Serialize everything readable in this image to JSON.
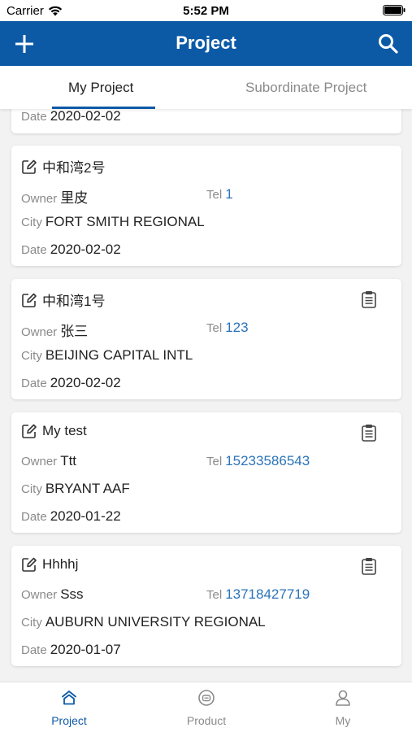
{
  "status_bar": {
    "carrier": "Carrier",
    "time": "5:52 PM"
  },
  "nav": {
    "title": "Project",
    "add_icon": "plus-icon",
    "search_icon": "search-icon"
  },
  "tabs": [
    {
      "label": "My Project",
      "active": true
    },
    {
      "label": "Subordinate Project",
      "active": false
    }
  ],
  "labels": {
    "owner": "Owner",
    "tel": "Tel",
    "city": "City",
    "date": "Date"
  },
  "projects": [
    {
      "name": "",
      "owner": "",
      "tel": "",
      "city": "",
      "date": "2020-02-02",
      "has_clipboard": false
    },
    {
      "name": "中和湾2号",
      "owner": "里皮",
      "tel": "1",
      "city": "FORT SMITH REGIONAL",
      "date": "2020-02-02",
      "has_clipboard": false
    },
    {
      "name": "中和湾1号",
      "owner": "张三",
      "tel": "123",
      "city": "BEIJING CAPITAL INTL",
      "date": "2020-02-02",
      "has_clipboard": true
    },
    {
      "name": "My test",
      "owner": "Ttt",
      "tel": "15233586543",
      "city": "BRYANT AAF",
      "date": "2020-01-22",
      "has_clipboard": true
    },
    {
      "name": "Hhhhj",
      "owner": "Sss",
      "tel": "13718427719",
      "city": "AUBURN UNIVERSITY REGIONAL",
      "date": "2020-01-07",
      "has_clipboard": true
    }
  ],
  "bottom_nav": [
    {
      "label": "Project",
      "icon": "home-icon",
      "active": true
    },
    {
      "label": "Product",
      "icon": "chat-bubble-icon",
      "active": false
    },
    {
      "label": "My",
      "icon": "user-icon",
      "active": false
    }
  ],
  "colors": {
    "primary": "#0c5aa6",
    "link": "#2b74b8",
    "label_gray": "#8a8a8a",
    "background": "#f2f2f2"
  }
}
